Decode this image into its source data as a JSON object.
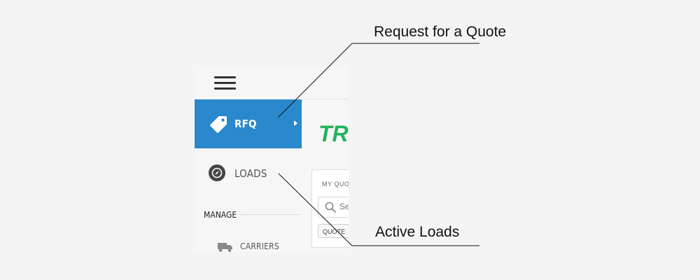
{
  "sidebar": {
    "items": [
      {
        "label": "RFQ",
        "icon": "tag-icon",
        "active": true
      },
      {
        "label": "LOADS",
        "icon": "compass-icon",
        "active": false
      }
    ],
    "section_label": "MANAGE",
    "sub_items": [
      {
        "label": "CARRIERS",
        "icon": "truck-icon"
      }
    ]
  },
  "main": {
    "brand_text": "TR",
    "card": {
      "title": "MY QUO",
      "search_placeholder": "Se",
      "quote_button": "QUOTE"
    }
  },
  "callouts": {
    "rfq": "Request for a Quote",
    "loads": "Active Loads"
  },
  "colors": {
    "active_nav": "#2a88cc",
    "brand_green": "#22b35b",
    "background": "#f4f4f4"
  }
}
